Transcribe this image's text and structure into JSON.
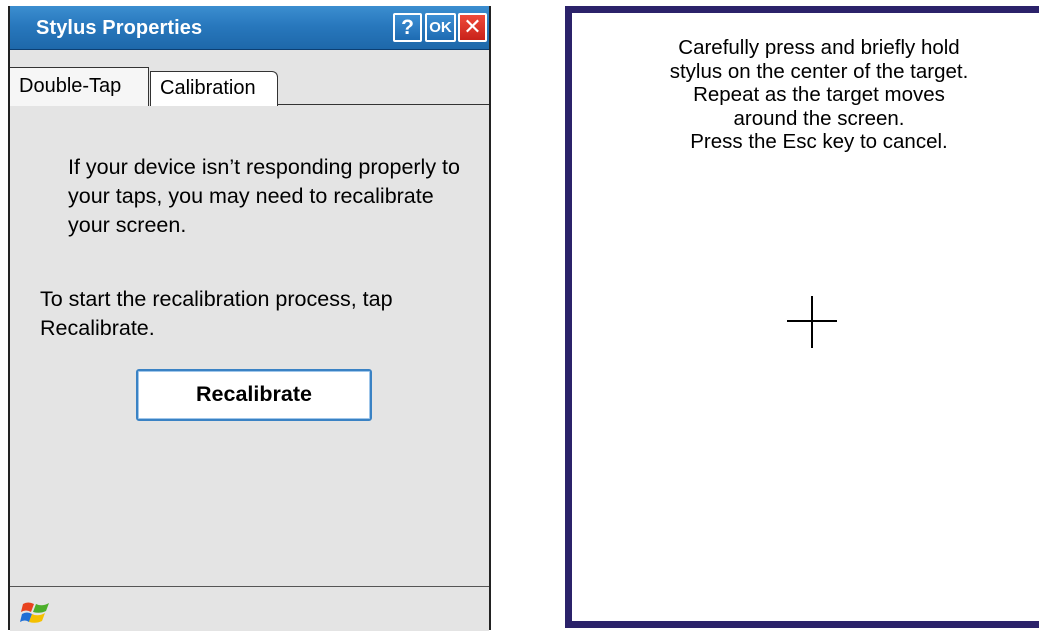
{
  "dialog": {
    "title": "Stylus Properties",
    "buttons": {
      "help": "?",
      "ok": "OK",
      "close": "✕"
    },
    "tabs": [
      {
        "label": "Double-Tap",
        "selected": false
      },
      {
        "label": "Calibration",
        "selected": true
      }
    ],
    "paragraph1": "If your device isn’t responding properly to your taps, you may need to recalibrate your screen.",
    "paragraph2": "To start the recalibration process, tap Recalibrate.",
    "recalibrate_button": "Recalibrate",
    "taskbar": {
      "start_icon": "windows-flag-icon"
    }
  },
  "calibration_screen": {
    "instructions": [
      "Carefully press and briefly hold",
      "stylus on the center of the target.",
      "Repeat as the target moves",
      "around the screen.",
      "Press the Esc key to cancel."
    ],
    "target_icon": "crosshair-icon"
  },
  "colors": {
    "titlebar": "#2878bd",
    "close_button": "#d9271e",
    "calibration_border": "#2b226a",
    "recalibrate_border": "#3a82c4"
  }
}
